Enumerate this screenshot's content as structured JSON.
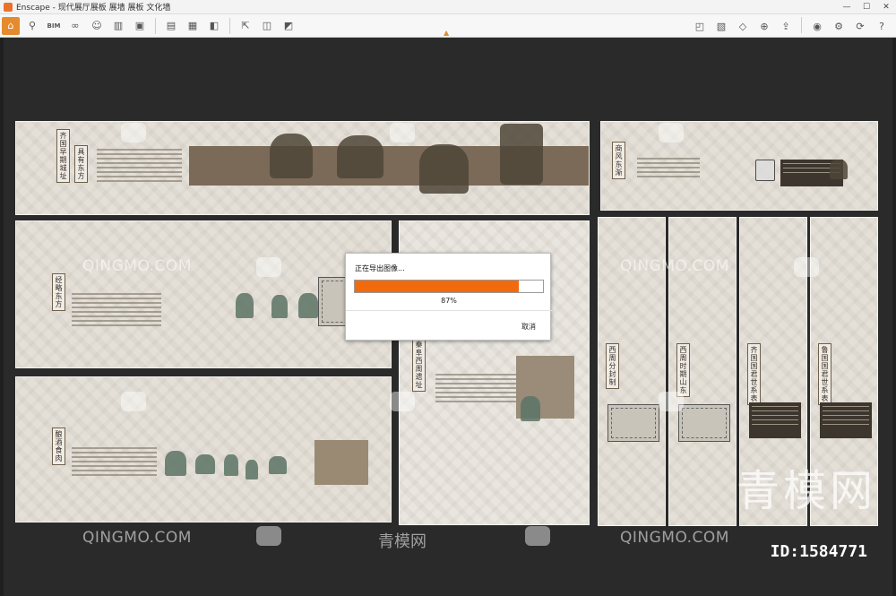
{
  "window": {
    "app_name": "Enscape",
    "title": "Enscape - 现代展厅展板 展墙 展板 文化墙",
    "controls": {
      "minimize": "—",
      "maximize": "☐",
      "close": "✕"
    }
  },
  "toolbar": {
    "left_icons": [
      "home-icon",
      "capture-icon",
      "bim-icon",
      "binoculars-icon",
      "walk-icon",
      "building-icon",
      "cube-icon",
      "video-icon",
      "screenshot-icon",
      "batch-render-icon",
      "panorama-icon",
      "export-icon",
      "web-standalone-icon",
      "vr-icon"
    ],
    "bim_label": "BIM",
    "right_icons": [
      "map-icon",
      "library-icon",
      "asset-icon",
      "material-icon",
      "upload-icon",
      "settings-icon",
      "eye-icon",
      "sync-icon",
      "help-icon"
    ]
  },
  "exhibit": {
    "panel_titles": {
      "top_left": "齐国早期城址",
      "top_left_sub": "具有东方",
      "mid_left": "经略东方",
      "bottom_left": "酿酒食肉",
      "center": "秦阜西周遗址",
      "top_right": "商风东渐",
      "col1": "西周分封制",
      "col2": "西周时期山东",
      "col3": "齐国国君世系表",
      "col4": "鲁国国君世系表"
    }
  },
  "export_dialog": {
    "title": "正在导出图像...",
    "progress": 0.87,
    "percent_text": "87%",
    "cancel_label": "取消"
  },
  "watermarks": {
    "site": "QINGMO.COM",
    "cn_small": "青模网",
    "cn_big": "青模网",
    "id_text": "ID:1584771"
  },
  "colors": {
    "progress_fill": "#f26a0e",
    "active_toolbar": "#e68a2e",
    "panel_bg": "#e4e0d8",
    "band_brown": "#7a6a57"
  }
}
